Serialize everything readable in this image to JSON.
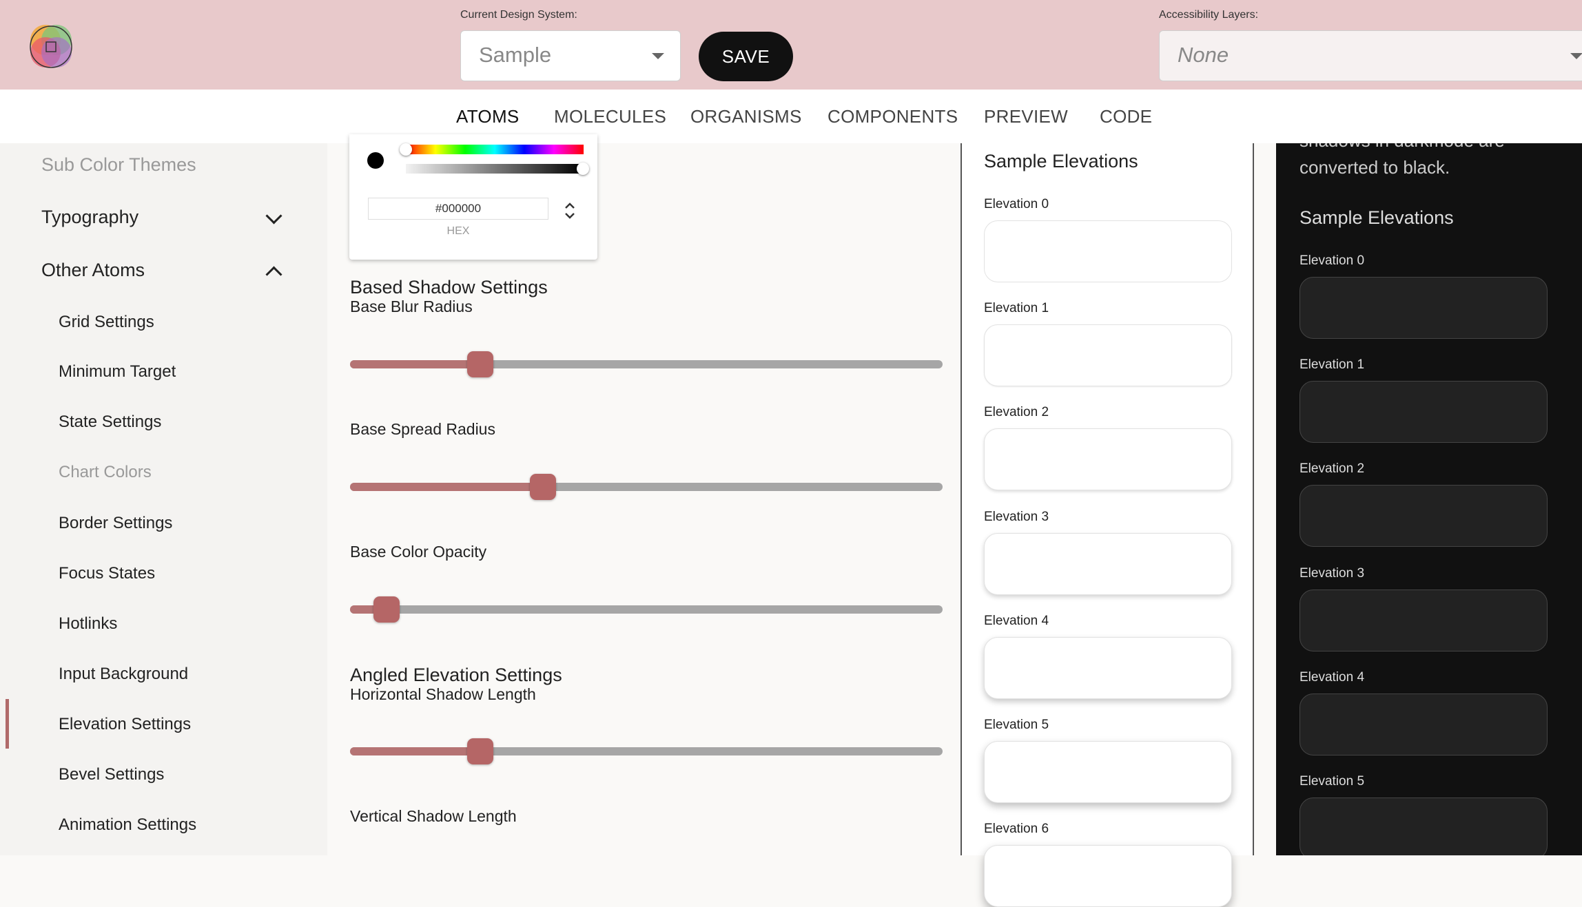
{
  "header": {
    "design_system_label": "Current Design System:",
    "design_system_value": "Sample",
    "save_label": "SAVE",
    "accessibility_label": "Accessibility Layers:",
    "accessibility_value": "None"
  },
  "tabs": [
    {
      "label": "ATOMS",
      "active": true
    },
    {
      "label": "MOLECULES"
    },
    {
      "label": "ORGANISMS"
    },
    {
      "label": "COMPONENTS"
    },
    {
      "label": "PREVIEW"
    },
    {
      "label": "CODE"
    }
  ],
  "sidebar": {
    "top_items": [
      {
        "label": "Sub Color Themes",
        "muted": true
      },
      {
        "label": "Typography",
        "expanded": false
      },
      {
        "label": "Other Atoms",
        "expanded": true
      }
    ],
    "sub_items": [
      {
        "label": "Grid Settings"
      },
      {
        "label": "Minimum Target"
      },
      {
        "label": "State Settings"
      },
      {
        "label": "Chart Colors",
        "muted": true
      },
      {
        "label": "Border Settings"
      },
      {
        "label": "Focus States"
      },
      {
        "label": "Hotlinks"
      },
      {
        "label": "Input Background"
      },
      {
        "label": "Elevation Settings",
        "active": true
      },
      {
        "label": "Bevel Settings"
      },
      {
        "label": "Animation Settings"
      }
    ]
  },
  "color_picker": {
    "hex_value": "#000000",
    "hex_label": "HEX"
  },
  "settings": {
    "based_title": "Based Shadow Settings",
    "base_blur_label": "Base Blur Radius",
    "base_blur_value": 0.22,
    "base_spread_label": "Base Spread Radius",
    "base_spread_value": 0.325,
    "base_opacity_label": "Base Color Opacity",
    "base_opacity_value": 0.062,
    "angled_title": "Angled Elevation Settings",
    "horizontal_label": "Horizontal Shadow Length",
    "horizontal_value": 0.22,
    "vertical_label": "Vertical Shadow Length"
  },
  "light_preview": {
    "title": "Sample Elevations",
    "elevations": [
      "Elevation 0",
      "Elevation 1",
      "Elevation 2",
      "Elevation 3",
      "Elevation 4",
      "Elevation 5",
      "Elevation 6"
    ]
  },
  "dark_preview": {
    "note_partial": "shadows in darkmode are",
    "note": "converted to black.",
    "title": "Sample Elevations",
    "elevations": [
      "Elevation 0",
      "Elevation 1",
      "Elevation 2",
      "Elevation 3",
      "Elevation 4",
      "Elevation 5"
    ]
  },
  "colors": {
    "header_bg": "#e8c9cb",
    "accent": "#b06a6a",
    "slider_fill": "#b57474",
    "dark_bg": "#111111"
  }
}
